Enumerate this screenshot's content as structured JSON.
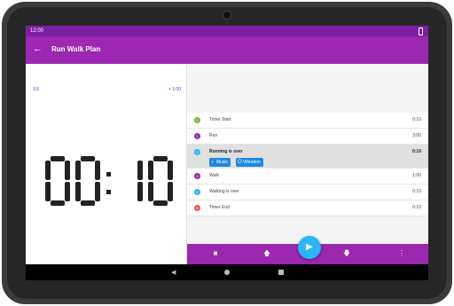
{
  "status": {
    "time": "12:00"
  },
  "app": {
    "title": "Run Walk Plan",
    "back_icon": "arrow-left-icon"
  },
  "timer": {
    "counter": "1/3",
    "add_label": "+ 1:00",
    "display": "00:10"
  },
  "steps": [
    {
      "index": "0",
      "name": "Timer Start",
      "duration": "0:10",
      "color": "#7cb342"
    },
    {
      "index": "1",
      "name": "Run",
      "duration": "3:00",
      "color": "#9c27b0"
    },
    {
      "index": "2",
      "name": "Running is over",
      "duration": "0:10",
      "color": "#29b6f6",
      "selected": true,
      "chips": [
        {
          "label": "Music",
          "icon": "music-icon"
        },
        {
          "label": "Vibration",
          "icon": "vibration-icon"
        }
      ]
    },
    {
      "index": "3",
      "name": "Walk",
      "duration": "1:00",
      "color": "#9c27b0"
    },
    {
      "index": "4",
      "name": "Walking is over",
      "duration": "0:10",
      "color": "#29b6f6"
    },
    {
      "index": "5",
      "name": "Timer End",
      "duration": "0:10",
      "color": "#ef5350"
    }
  ],
  "bottom_bar": {
    "buttons": [
      "stop-icon",
      "arrow-up-icon",
      "play-icon",
      "arrow-down-icon",
      "more-vert-icon"
    ]
  },
  "colors": {
    "primary": "#9c27b0",
    "primary_dark": "#7b1fa2",
    "accent": "#29b6f6"
  }
}
